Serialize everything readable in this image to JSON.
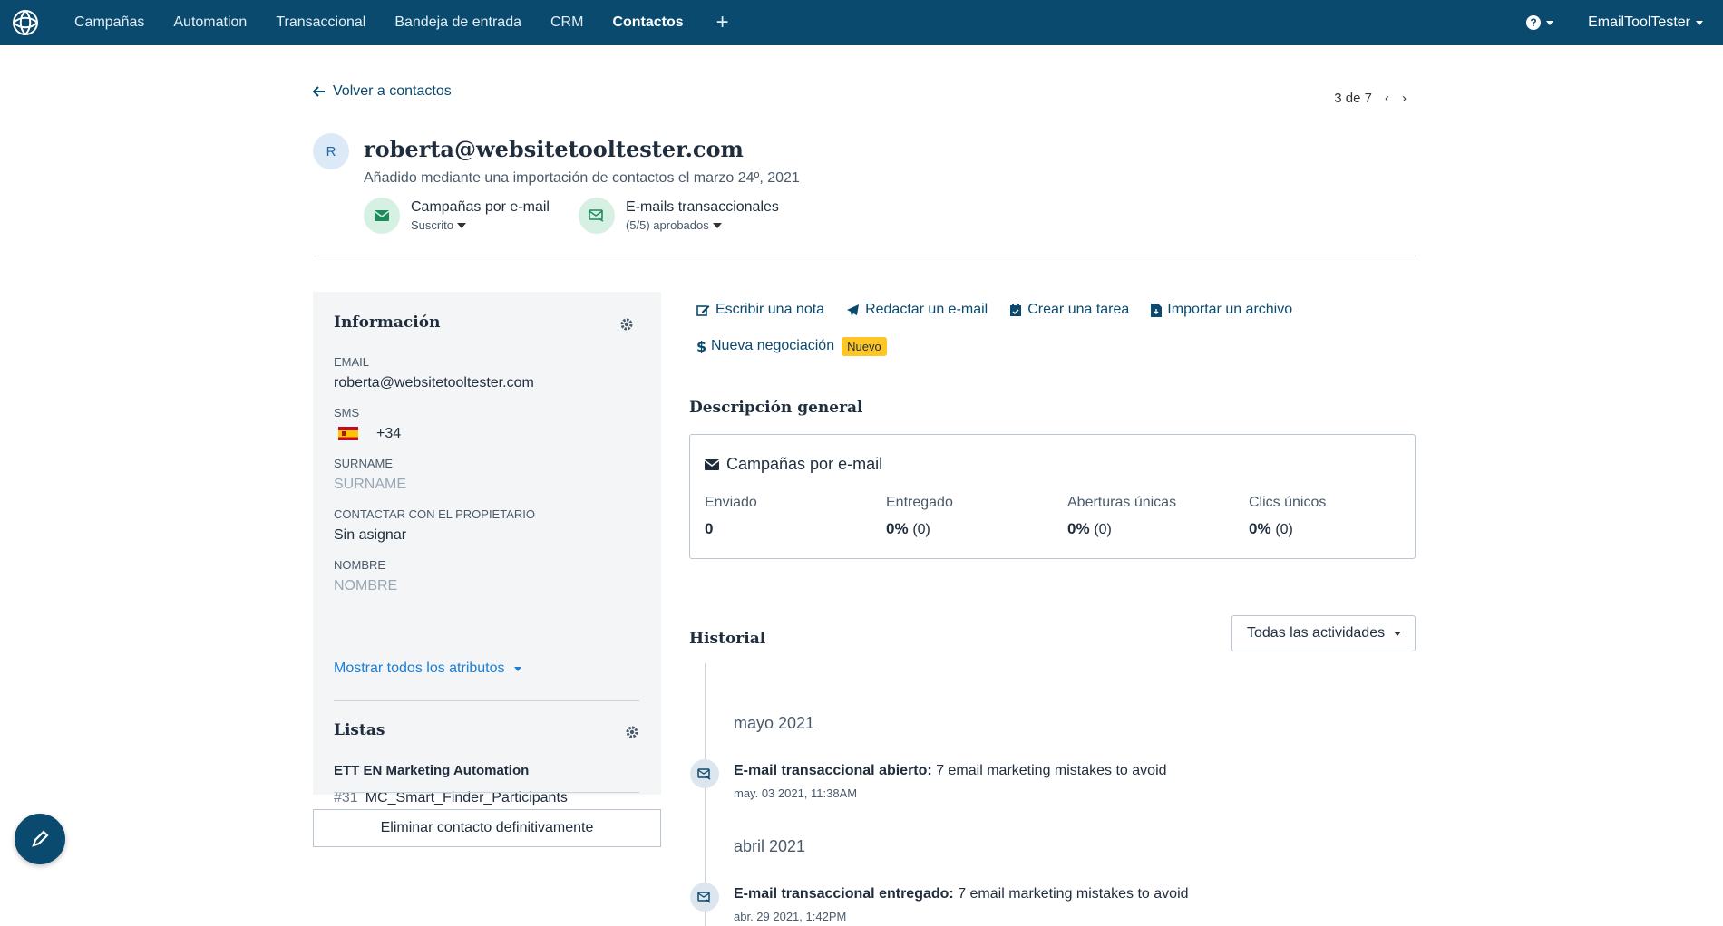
{
  "nav": {
    "items": [
      {
        "label": "Campañas"
      },
      {
        "label": "Automation"
      },
      {
        "label": "Transaccional"
      },
      {
        "label": "Bandeja de entrada"
      },
      {
        "label": "CRM"
      },
      {
        "label": "Contactos"
      }
    ],
    "plus": "+",
    "help": "?",
    "user": "EmailToolTester"
  },
  "back_label": "Volver a contactos",
  "pager": {
    "text": "3 de 7"
  },
  "contact": {
    "avatar": "R",
    "email": "roberta@websitetooltester.com",
    "added": "Añadido mediante una importación de contactos el marzo 24º, 2021"
  },
  "subscriptions": [
    {
      "title": "Campañas por e-mail",
      "status": "Suscrito"
    },
    {
      "title": "E-mails transaccionales",
      "status": "(5/5) aprobados"
    }
  ],
  "info": {
    "title": "Información",
    "attributes": [
      {
        "label": "EMAIL",
        "value": "roberta@websitetooltester.com"
      },
      {
        "label": "SMS",
        "value": "+34"
      },
      {
        "label": "SURNAME",
        "value": "SURNAME"
      },
      {
        "label": "CONTACTAR CON EL PROPIETARIO",
        "value": "Sin asignar"
      },
      {
        "label": "NOMBRE",
        "value": "NOMBRE"
      }
    ],
    "show_all": "Mostrar todos los atributos"
  },
  "lists": {
    "title": "Listas",
    "group": "ETT EN Marketing Automation",
    "item_num": "#31",
    "item_name": "MC_Smart_Finder_Participants"
  },
  "delete_label": "Eliminar contacto definitivamente",
  "actions": [
    {
      "label": "Escribir una nota"
    },
    {
      "label": "Redactar un e-mail"
    },
    {
      "label": "Crear una tarea"
    },
    {
      "label": "Importar un archivo"
    },
    {
      "label": "Nueva negociación"
    }
  ],
  "new_badge": "Nuevo",
  "overview": {
    "title": "Descripción general",
    "box_title": "Campañas por e-mail",
    "stats": [
      {
        "label": "Enviado",
        "value": "0",
        "count": ""
      },
      {
        "label": "Entregado",
        "value": "0%",
        "count": "(0)"
      },
      {
        "label": "Aberturas únicas",
        "value": "0%",
        "count": "(0)"
      },
      {
        "label": "Clics únicos",
        "value": "0%",
        "count": "(0)"
      }
    ]
  },
  "history": {
    "title": "Historial",
    "filter": "Todas las actividades",
    "months": [
      "mayo 2021",
      "abril 2021"
    ],
    "events": [
      {
        "type": "E-mail transaccional abierto:",
        "subject": "7 email marketing mistakes to avoid",
        "time": "may. 03 2021, 11:38AM"
      },
      {
        "type": "E-mail transaccional entregado:",
        "subject": "7 email marketing mistakes to avoid",
        "time": "abr. 29 2021, 1:42PM"
      }
    ]
  },
  "colors": {
    "nav_bg": "#0b4a6f",
    "accent_link": "#1a7fd4",
    "badge": "#ffc524",
    "sub_icon_bg": "#d6f0e4"
  }
}
